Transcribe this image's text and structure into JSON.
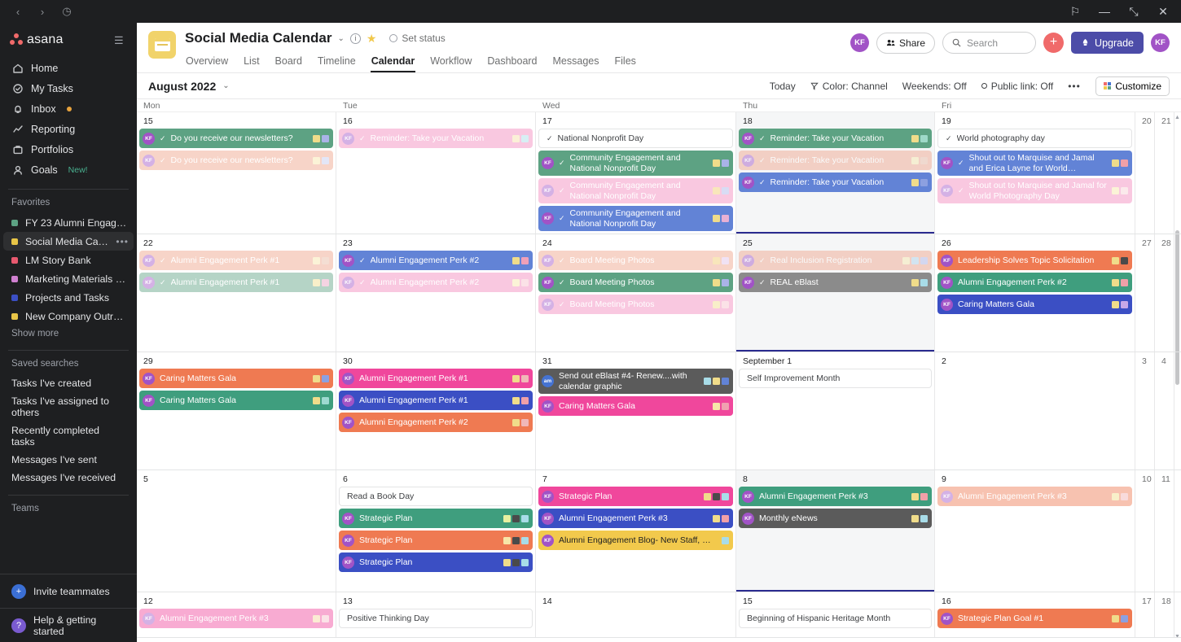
{
  "titlebar": {
    "back": "‹",
    "forward": "›",
    "history": "◷",
    "min": "—",
    "restore": "⤡",
    "close": "✕",
    "notify": "⚐"
  },
  "sidebar": {
    "brand": "asana",
    "nav": [
      {
        "label": "Home",
        "icon": "home-icon"
      },
      {
        "label": "My Tasks",
        "icon": "check-circle-icon"
      },
      {
        "label": "Inbox",
        "icon": "bell-icon",
        "dot": true
      },
      {
        "label": "Reporting",
        "icon": "chart-line-icon"
      },
      {
        "label": "Portfolios",
        "icon": "briefcase-icon"
      },
      {
        "label": "Goals",
        "icon": "target-icon",
        "tag": "New!"
      }
    ],
    "favorites_header": "Favorites",
    "favorites": [
      {
        "label": "FY 23 Alumni Engage...",
        "color": "#5da283"
      },
      {
        "label": "Social Media Calendar",
        "color": "#e8c547",
        "active": true,
        "more": "•••"
      },
      {
        "label": "LM Story Bank",
        "color": "#e8596f"
      },
      {
        "label": "Marketing Materials R...",
        "color": "#d israeli"
      },
      {
        "label": "Projects and Tasks",
        "color": "#3b4fc4"
      },
      {
        "label": "New Company Outrea...",
        "color": "#e8c547"
      }
    ],
    "show_more": "Show more",
    "saved_header": "Saved searches",
    "saved_searches": [
      "Tasks I've created",
      "Tasks I've assigned to others",
      "Recently completed tasks",
      "Messages I've sent",
      "Messages I've received"
    ],
    "teams_header": "Teams",
    "invite": "Invite teammates",
    "help": "Help & getting started"
  },
  "header": {
    "project_title": "Social Media Calendar",
    "caret": "⌄",
    "info_icon": "i",
    "star_icon": "★",
    "set_status": "Set status",
    "tabs": [
      {
        "label": "Overview",
        "active": false
      },
      {
        "label": "List",
        "active": false
      },
      {
        "label": "Board",
        "active": false
      },
      {
        "label": "Timeline",
        "active": false
      },
      {
        "label": "Calendar",
        "active": true
      },
      {
        "label": "Workflow",
        "active": false
      },
      {
        "label": "Dashboard",
        "active": false
      },
      {
        "label": "Messages",
        "active": false
      },
      {
        "label": "Files",
        "active": false
      }
    ],
    "avatar_left": "KF",
    "share": "Share",
    "search_placeholder": "Search",
    "plus": "+",
    "upgrade": "Upgrade",
    "avatar_right": "KF"
  },
  "toolbar": {
    "month": "August 2022",
    "month_caret": "⌄",
    "today": "Today",
    "color": "Color: Channel",
    "weekends": "Weekends: Off",
    "public_link": "Public link: Off",
    "more": "•••",
    "customize": "Customize"
  },
  "dow": [
    "Mon",
    "Tue",
    "Wed",
    "Thu",
    "Fri"
  ],
  "colors": {
    "green": "#5da283",
    "peach": "#efa287",
    "pink": "#f286bc",
    "blue": "#6283d6",
    "orange": "#ef7a52",
    "gray": "#8b8b8b",
    "hotpink": "#f0479c",
    "yellow": "#f2c94c",
    "darkgray": "#5b5b5b",
    "magenta": "#e24fa0",
    "indigo": "#3b4fc4",
    "teal": "#3f9e7e"
  },
  "weeks": [
    {
      "days": [
        {
          "num": "15",
          "events": [
            {
              "title": "Do you receive our newsletters?",
              "bg": "#5da283",
              "av": "KF",
              "check": true,
              "tags": [
                "#f0dc8a",
                "#aab3e8"
              ]
            },
            {
              "title": "Do you receive our newsletters?",
              "bg": "#efa287",
              "av": "KF",
              "check": true,
              "faded": true,
              "tags": [
                "#f7e6a8",
                "#c2c9ee"
              ]
            }
          ]
        },
        {
          "num": "16",
          "events": [
            {
              "title": "Reminder: Take your Vacation",
              "bg": "#f286bc",
              "av": "KF",
              "check": true,
              "faded": true,
              "tags": [
                "#f7e0a8",
                "#a8dce8"
              ]
            }
          ]
        },
        {
          "num": "17",
          "events": [
            {
              "title": "National Nonprofit Day",
              "plain": true,
              "check": true
            },
            {
              "title": "Community Engagement and National Nonprofit Day",
              "bg": "#5da283",
              "av": "KF",
              "check": true,
              "tall": true,
              "tags": [
                "#f0dc8a",
                "#aab3e8"
              ]
            },
            {
              "title": "Community Engagement and National Nonprofit Day",
              "bg": "#f286bc",
              "av": "KF",
              "check": true,
              "tall": true,
              "faded": true,
              "tags": [
                "#f0c86a",
                "#aab3e8"
              ]
            },
            {
              "title": "Community Engagement and National Nonprofit Day",
              "bg": "#6283d6",
              "av": "KF",
              "check": true,
              "tall": true,
              "tags": [
                "#f0dc8a",
                "#e8b0d4"
              ]
            }
          ]
        },
        {
          "num": "18",
          "today": true,
          "events": [
            {
              "title": "Reminder: Take your Vacation",
              "bg": "#5da283",
              "av": "KF",
              "check": true,
              "tags": [
                "#f0dc8a",
                "#9ed9c8"
              ]
            },
            {
              "title": "Reminder: Take your Vacation",
              "bg": "#efa287",
              "av": "KF",
              "check": true,
              "faded": true,
              "tags": [
                "#f7e6a8",
                "#e8b8a0"
              ]
            },
            {
              "title": "Reminder: Take your Vacation",
              "bg": "#6283d6",
              "av": "KF",
              "check": true,
              "tags": [
                "#f0dc8a",
                "#8ca0e0"
              ]
            }
          ]
        },
        {
          "num": "19",
          "events": [
            {
              "title": "World photography day",
              "plain": true,
              "check": true
            },
            {
              "title": "Shout out to Marquise and Jamal and Erica Layne for World Photography Day",
              "bg": "#6283d6",
              "av": "KF",
              "check": true,
              "tall": true,
              "tags": [
                "#f0dc8a",
                "#f0a0a8"
              ]
            },
            {
              "title": "Shout out to Marquise and Jamal for World Photography Day",
              "bg": "#f286bc",
              "av": "KF",
              "check": true,
              "tall": true,
              "faded": true,
              "tags": [
                "#f7e6a8",
                "#f7d0d4"
              ]
            }
          ]
        },
        {
          "num": "20",
          "narrow": true,
          "events": []
        },
        {
          "num": "21",
          "narrow": true,
          "events": []
        }
      ]
    },
    {
      "days": [
        {
          "num": "22",
          "events": [
            {
              "title": "Alumni Engagement Perk #1",
              "bg": "#efa287",
              "av": "KF",
              "check": true,
              "faded": true,
              "tags": [
                "#f7e6a8",
                "#e8b8a0"
              ]
            },
            {
              "title": "Alumni Engagement Perk #1",
              "bg": "#5da283",
              "av": "KF",
              "check": true,
              "faded": true,
              "tags": [
                "#f0dc8a",
                "#e8a0c0"
              ]
            }
          ]
        },
        {
          "num": "23",
          "events": [
            {
              "title": "Alumni Engagement Perk #2",
              "bg": "#6283d6",
              "av": "KF",
              "check": true,
              "tags": [
                "#f0dc8a",
                "#f0a0b8"
              ]
            },
            {
              "title": "Alumni Engagement Perk #2",
              "bg": "#f286bc",
              "av": "KF",
              "check": true,
              "faded": true,
              "tags": [
                "#f7e6a8",
                "#f7c0cc"
              ]
            }
          ]
        },
        {
          "num": "24",
          "events": [
            {
              "title": "Board Meeting Photos",
              "bg": "#efa287",
              "av": "KF",
              "check": true,
              "faded": true,
              "tags": [
                "#f0c86a",
                "#e0c0e8"
              ]
            },
            {
              "title": "Board Meeting Photos",
              "bg": "#5da283",
              "av": "KF",
              "check": true,
              "tags": [
                "#f0dc8a",
                "#aab3e8"
              ]
            },
            {
              "title": "Board Meeting Photos",
              "bg": "#f286bc",
              "av": "KF",
              "check": true,
              "faded": true,
              "tags": [
                "#f0dc8a",
                "#f7c0cc"
              ]
            }
          ]
        },
        {
          "num": "25",
          "today": true,
          "events": [
            {
              "title": "Real Inclusion Registration",
              "bg": "#efa287",
              "av": "KF",
              "check": true,
              "faded": true,
              "tags": [
                "#f7e6a8",
                "#a8d0e8",
                "#aab3e8"
              ]
            },
            {
              "title": "REAL eBlast",
              "bg": "#8b8b8b",
              "av": "KF",
              "check": true,
              "tags": [
                "#f0dc8a",
                "#a8dce8"
              ]
            }
          ]
        },
        {
          "num": "26",
          "events": [
            {
              "title": "Leadership Solves Topic Solicitation",
              "bg": "#ef7a52",
              "av": "KF",
              "tags": [
                "#f0dc8a",
                "#4a4a4a"
              ]
            },
            {
              "title": "Alumni Engagement Perk #2",
              "bg": "#3f9e7e",
              "av": "KF",
              "tags": [
                "#f0dc8a",
                "#f0a0a8"
              ]
            },
            {
              "title": "Caring Matters Gala",
              "bg": "#3b4fc4",
              "av": "KF",
              "tags": [
                "#f0dc8a",
                "#c8a8e8"
              ]
            }
          ]
        },
        {
          "num": "27",
          "narrow": true,
          "events": []
        },
        {
          "num": "28",
          "narrow": true,
          "events": []
        }
      ]
    },
    {
      "days": [
        {
          "num": "29",
          "events": [
            {
              "title": "Caring Matters Gala",
              "bg": "#ef7a52",
              "av": "KF",
              "tags": [
                "#f0dc8a",
                "#8ca0e0"
              ]
            },
            {
              "title": "Caring Matters Gala",
              "bg": "#3f9e7e",
              "av": "KF",
              "tags": [
                "#f0dc8a",
                "#9ed9d0"
              ]
            }
          ]
        },
        {
          "num": "30",
          "events": [
            {
              "title": "Alumni Engagement Perk #1",
              "bg": "#f0479c",
              "av": "KF",
              "tags": [
                "#f0dc8a",
                "#f0b8b8"
              ]
            },
            {
              "title": "Alumni Engagement Perk #1",
              "bg": "#3b4fc4",
              "av": "KF",
              "tags": [
                "#f0dc8a",
                "#f0a0a8"
              ]
            },
            {
              "title": "Alumni Engagement Perk #2",
              "bg": "#ef7a52",
              "av": "KF",
              "tags": [
                "#f0dc8a",
                "#f0b8b8"
              ]
            }
          ]
        },
        {
          "num": "31",
          "events": [
            {
              "title": "Send out eBlast #4- Renew....with calendar graphic",
              "bg": "#5b5b5b",
              "av": "am",
              "avblue": true,
              "tall": true,
              "tags": [
                "#a8dce8",
                "#f0dc8a",
                "#6283d6"
              ]
            },
            {
              "title": "Caring Matters Gala",
              "bg": "#f0479c",
              "av": "KF",
              "tags": [
                "#f7e6a8",
                "#f0a0b0"
              ]
            }
          ]
        },
        {
          "num": "September 1",
          "wideLabel": true,
          "events": [
            {
              "title": "Self Improvement Month",
              "plain": true
            }
          ]
        },
        {
          "num": "2",
          "events": []
        },
        {
          "num": "3",
          "narrow": true,
          "events": []
        },
        {
          "num": "4",
          "narrow": true,
          "events": []
        }
      ]
    },
    {
      "days": [
        {
          "num": "5",
          "events": []
        },
        {
          "num": "6",
          "events": [
            {
              "title": "Read a Book Day",
              "plain": true
            },
            {
              "title": "Strategic Plan",
              "bg": "#3f9e7e",
              "av": "KF",
              "tags": [
                "#e8f0a0",
                "#4a4a4a",
                "#a8dce8"
              ]
            },
            {
              "title": "Strategic Plan",
              "bg": "#ef7a52",
              "av": "KF",
              "tags": [
                "#f7e6a8",
                "#4a4a4a",
                "#a8dce8"
              ]
            },
            {
              "title": "Strategic Plan",
              "bg": "#3b4fc4",
              "av": "KF",
              "tags": [
                "#f0dc8a",
                "#4a4a4a",
                "#a8dce8"
              ]
            }
          ]
        },
        {
          "num": "7",
          "events": [
            {
              "title": "Strategic Plan",
              "bg": "#f0479c",
              "av": "KF",
              "tags": [
                "#f0dc8a",
                "#4a4a4a",
                "#a8dce8"
              ]
            },
            {
              "title": "Alumni Engagement Perk #3",
              "bg": "#3b4fc4",
              "av": "KF",
              "tags": [
                "#f0dc8a",
                "#f0a0a8"
              ]
            },
            {
              "title": "Alumni Engagement Blog- New Staff, Who dis?",
              "bg": "#f2c94c",
              "av": "KF",
              "dark": true,
              "tags": [
                "#a8dce8"
              ]
            }
          ]
        },
        {
          "num": "8",
          "today": true,
          "events": [
            {
              "title": "Alumni Engagement Perk #3",
              "bg": "#3f9e7e",
              "av": "KF",
              "tags": [
                "#f0dc8a",
                "#f0a0a8"
              ]
            },
            {
              "title": "Monthly eNews",
              "bg": "#5b5b5b",
              "av": "KF",
              "tags": [
                "#f0dc8a",
                "#a8dce8"
              ]
            }
          ]
        },
        {
          "num": "9",
          "events": [
            {
              "title": "Alumni Engagement Perk #3",
              "bg": "#ef7a52",
              "av": "KF",
              "faded": true,
              "tags": [
                "#f0dc8a",
                "#f0b0b0"
              ]
            }
          ]
        },
        {
          "num": "10",
          "narrow": true,
          "events": []
        },
        {
          "num": "11",
          "narrow": true,
          "events": []
        }
      ]
    },
    {
      "days": [
        {
          "num": "12",
          "events": [
            {
              "title": "Alumni Engagement Perk #3",
              "bg": "#f0479c",
              "av": "KF",
              "faded": true,
              "tags": [
                "#f7d6a0",
                "#f7c0cc"
              ]
            }
          ]
        },
        {
          "num": "13",
          "events": [
            {
              "title": "Positive Thinking Day",
              "plain": true
            }
          ]
        },
        {
          "num": "14",
          "events": []
        },
        {
          "num": "15",
          "events": [
            {
              "title": "Beginning of Hispanic Heritage Month",
              "plain": true
            }
          ]
        },
        {
          "num": "16",
          "events": [
            {
              "title": "Strategic Plan Goal #1",
              "bg": "#ef7a52",
              "av": "KF",
              "tags": [
                "#f0dc8a",
                "#8ca0e0"
              ]
            }
          ]
        },
        {
          "num": "17",
          "narrow": true,
          "events": []
        },
        {
          "num": "18",
          "narrow": true,
          "events": []
        }
      ]
    }
  ]
}
